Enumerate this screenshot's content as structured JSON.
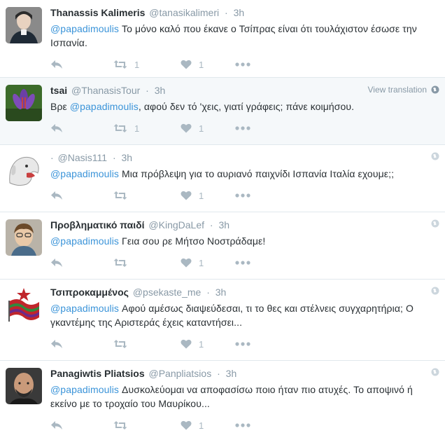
{
  "tweets": [
    {
      "name": "Thanassis Kalimeris",
      "handle": "@tanasikalimeri",
      "time": "3h",
      "mention": "@papadimoulis",
      "text": " Το μόνο καλό που έκανε ο Τσίπρας είναι ότι τουλάχιστον έσωσε την Ισπανία.",
      "retweets": "1",
      "likes": "1",
      "corner_label": "",
      "highlight": false
    },
    {
      "name": "tsai",
      "handle": "@ThanasisTour",
      "time": "3h",
      "mention": "@papadimoulis",
      "text": ", αφού δεν τό 'χεις, γιατί γράφεις; πάνε κοιμήσου.",
      "mention_prefix": "Βρε ",
      "retweets": "1",
      "likes": "1",
      "corner_label": "View translation",
      "highlight": true
    },
    {
      "name": "·",
      "handle": "@Nasis111",
      "time": "3h",
      "mention": "@papadimoulis",
      "text": " Μια πρόβλεψη για το αυριανό παιχνίδι Ισπανία Ιταλία εχουμε;;",
      "retweets": "",
      "likes": "1",
      "corner_label": "",
      "highlight": false
    },
    {
      "name": "Προβληματικό παιδί",
      "handle": "@KingDaLef",
      "time": "3h",
      "mention": "@papadimoulis",
      "text": " Γεια σου ρε Μήτσο Νοστράδαμε!",
      "retweets": "",
      "likes": "1",
      "corner_label": "",
      "highlight": false
    },
    {
      "name": "Τσιπροκαμμένος",
      "handle": "@psekaste_me",
      "time": "3h",
      "mention": "@papadimoulis",
      "text": " Αφού αμέσως διαψεύδεσαι, τι το θες και στέλνεις συγχαρητήρια; Ο γκαντέμης της Αριστεράς έχεις καταντήσει...",
      "retweets": "",
      "likes": "1",
      "corner_label": "",
      "highlight": false
    },
    {
      "name": "Panagiwtis Pliatsios",
      "handle": "@Panpliatsios",
      "time": "3h",
      "mention": "@papadimoulis",
      "text": " Δυσκολεύομαι να αποφασίσω ποιο ήταν πιο ατυχές. Το αποψινό ή εκείνο με το τροχαίο του Μαυρίκου...",
      "retweets": "",
      "likes": "1",
      "corner_label": "",
      "highlight": false
    }
  ],
  "icons": {
    "reply": "reply-icon",
    "retweet": "retweet-icon",
    "like": "heart-icon",
    "more": "more-icon",
    "globe": "globe-icon"
  },
  "colors": {
    "mention": "#3b94d9",
    "muted": "#8899a6",
    "action": "#aab8c2",
    "highlight_bg": "#f5f8fa"
  }
}
